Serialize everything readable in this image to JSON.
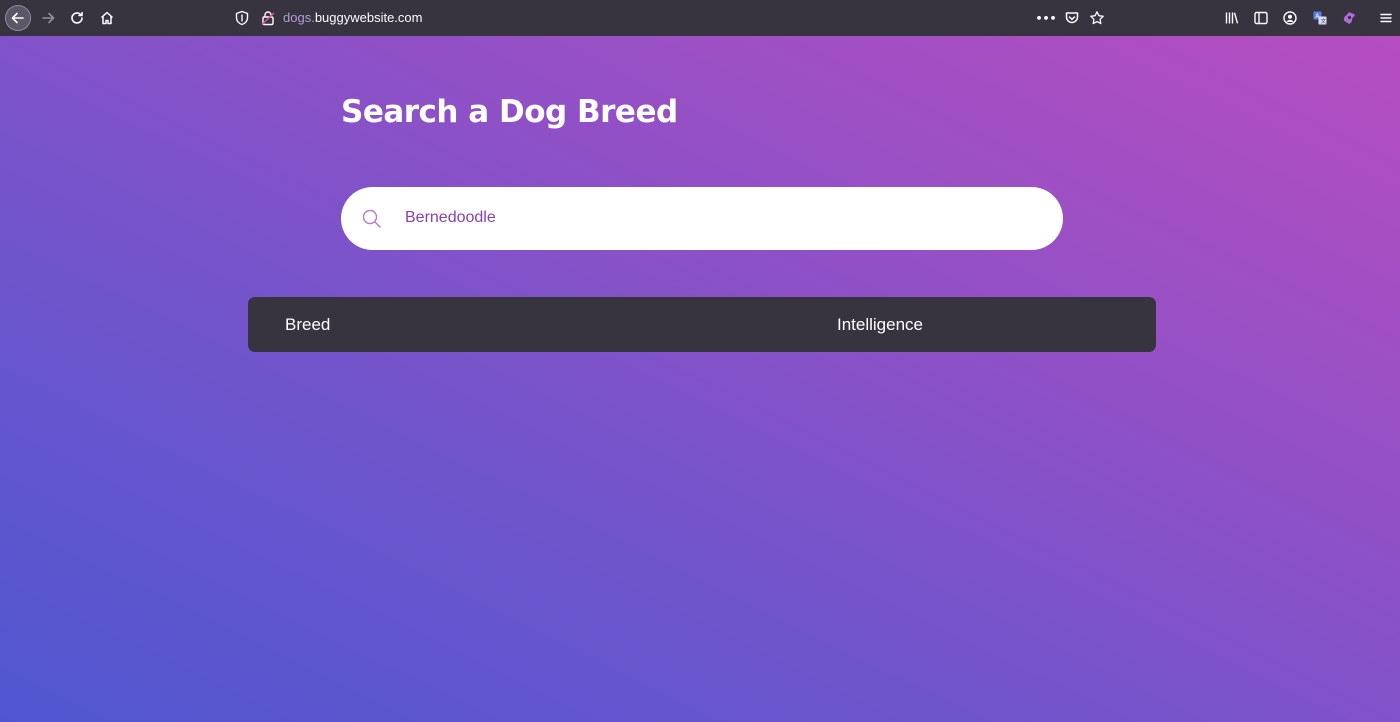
{
  "browser": {
    "url_subdomain": "dogs.",
    "url_domain": "buggywebsite.com",
    "more_label": "•••"
  },
  "page": {
    "title": "Search a Dog Breed",
    "search": {
      "value": "Bernedoodle",
      "icon": "search-icon"
    },
    "table": {
      "columns": [
        "Breed",
        "Intelligence"
      ],
      "rows": []
    }
  },
  "colors": {
    "toolbar": "#38343f",
    "gradient_start": "#4f57d0",
    "gradient_end": "#b64ec0",
    "search_text": "#8a3fb3",
    "table_header": "#38343f"
  }
}
